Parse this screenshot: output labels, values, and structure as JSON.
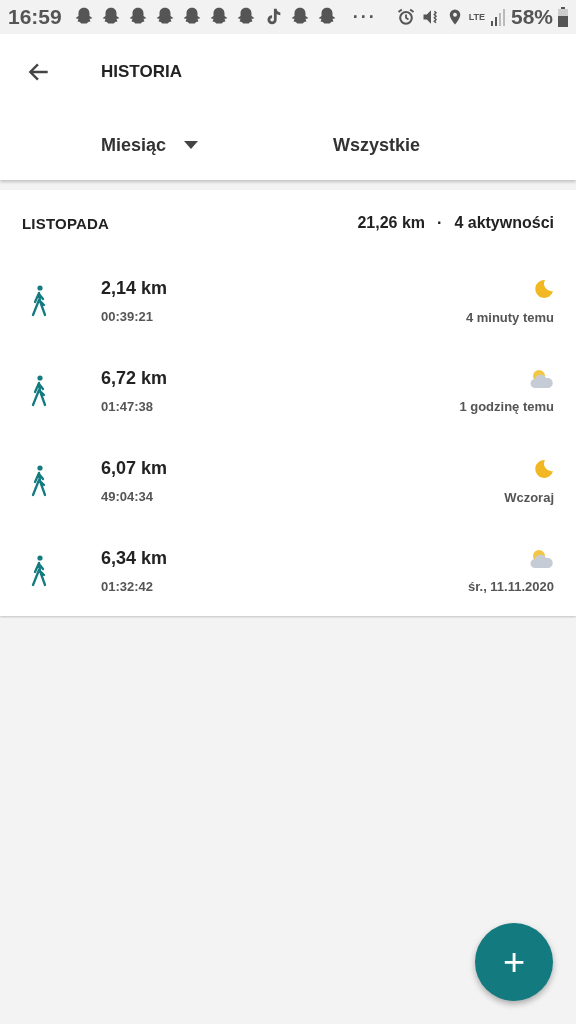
{
  "status_bar": {
    "time": "16:59",
    "notifications": [
      {
        "kind": "ghost"
      },
      {
        "kind": "ghost"
      },
      {
        "kind": "ghost"
      },
      {
        "kind": "ghost"
      },
      {
        "kind": "ghost"
      },
      {
        "kind": "ghost"
      },
      {
        "kind": "ghost"
      },
      {
        "kind": "note"
      },
      {
        "kind": "ghost"
      },
      {
        "kind": "ghost"
      }
    ],
    "more": "···",
    "network": "LTE",
    "battery": "58%"
  },
  "app_bar": {
    "title": "HISTORIA"
  },
  "filters": [
    {
      "label": "Miesiąc",
      "kind": "dropdown"
    },
    {
      "label": "Wszystkie",
      "kind": "plain"
    }
  ],
  "section": {
    "title": "LISTOPADA",
    "distance": "21,26 km",
    "separator": "·",
    "count": "4 aktywności"
  },
  "activities": [
    {
      "distance": "2,14 km",
      "duration": "00:39:21",
      "kind": "night",
      "when": "4 minuty temu"
    },
    {
      "distance": "6,72 km",
      "duration": "01:47:38",
      "kind": "cloudy",
      "when": "1 godzinę temu"
    },
    {
      "distance": "6,07 km",
      "duration": "49:04:34",
      "kind": "night",
      "when": "Wczoraj"
    },
    {
      "distance": "6,34 km",
      "duration": "01:32:42",
      "kind": "cloudy",
      "when": "śr., 11.11.2020"
    }
  ],
  "fab": {
    "label": "+"
  }
}
